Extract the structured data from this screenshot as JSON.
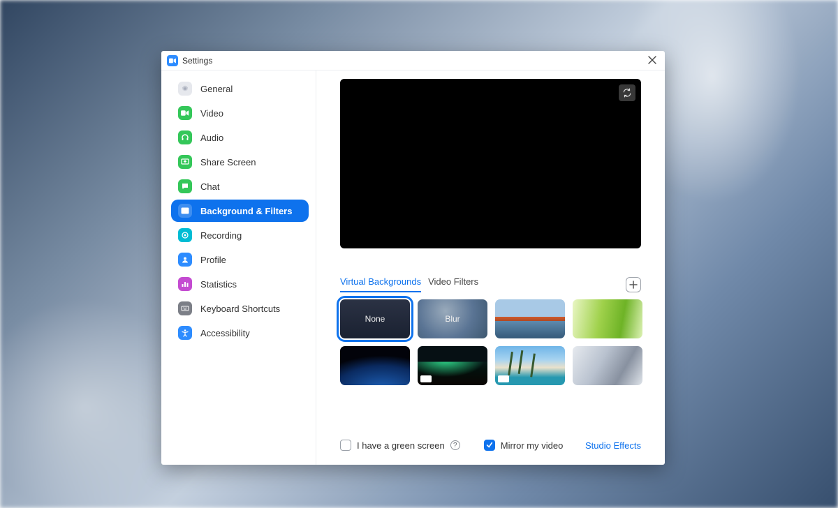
{
  "window": {
    "title": "Settings"
  },
  "sidebar": {
    "items": [
      {
        "label": "General"
      },
      {
        "label": "Video"
      },
      {
        "label": "Audio"
      },
      {
        "label": "Share Screen"
      },
      {
        "label": "Chat"
      },
      {
        "label": "Background & Filters",
        "active": true
      },
      {
        "label": "Recording"
      },
      {
        "label": "Profile"
      },
      {
        "label": "Statistics"
      },
      {
        "label": "Keyboard Shortcuts"
      },
      {
        "label": "Accessibility"
      }
    ]
  },
  "tabs": {
    "virtual_backgrounds": "Virtual Backgrounds",
    "video_filters": "Video Filters",
    "active": "virtual_backgrounds"
  },
  "thumbs": {
    "none": "None",
    "blur": "Blur"
  },
  "footer": {
    "green_screen": "I have a green screen",
    "mirror": "Mirror my video",
    "studio_effects": "Studio Effects",
    "green_screen_checked": false,
    "mirror_checked": true
  }
}
